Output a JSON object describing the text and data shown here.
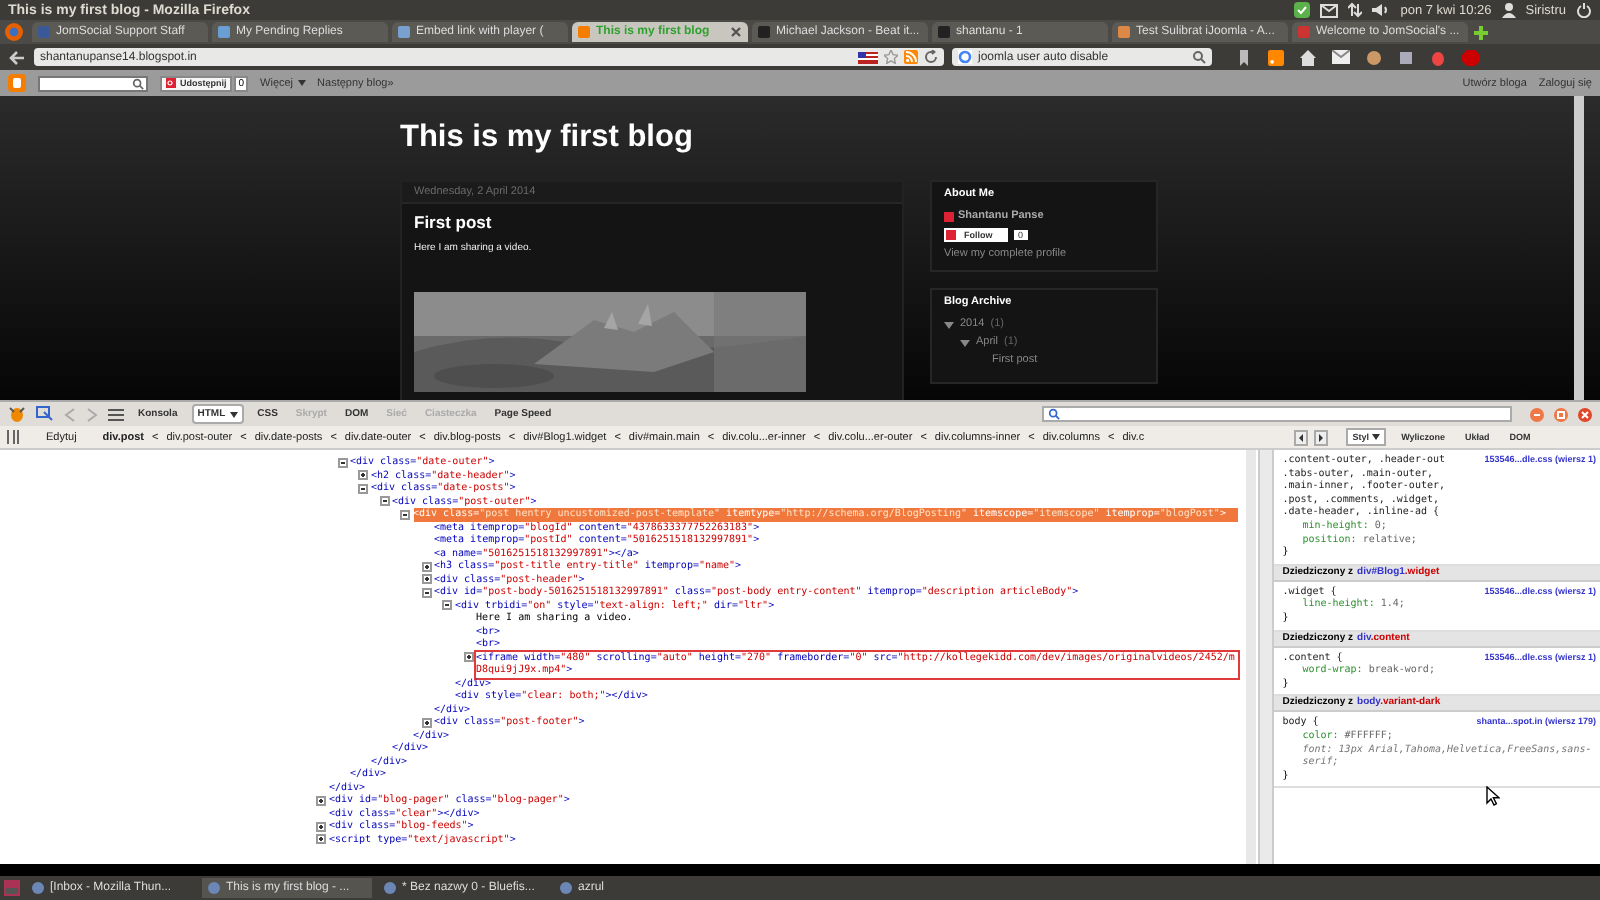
{
  "window": {
    "title": "This is my first blog - Mozilla Firefox"
  },
  "top_panel": {
    "clock": "pon 7 kwi 10:26",
    "user": "Siristru"
  },
  "browser_tabs": [
    {
      "label": "JomSocial Support Staff",
      "selected": false
    },
    {
      "label": "My Pending Replies",
      "selected": false
    },
    {
      "label": "Embed link with player (",
      "selected": false
    },
    {
      "label": "This is my first blog",
      "selected": true
    },
    {
      "label": "Michael Jackson - Beat it...",
      "selected": false
    },
    {
      "label": "shantanu - 1",
      "selected": false
    },
    {
      "label": "Test Sulibrat iJoomla - A...",
      "selected": false
    },
    {
      "label": "Welcome to JomSocial's ...",
      "selected": false
    }
  ],
  "address_bar": {
    "url": "shantanupanse14.blogspot.in"
  },
  "search_bar": {
    "value": "joomla user auto disable"
  },
  "blogger_navbar": {
    "share_button": "Udostępnij",
    "share_count": "0",
    "more_menu": "Więcej",
    "next_blog": "Następny blog»",
    "create_blog": "Utwórz bloga",
    "sign_in": "Zaloguj się"
  },
  "blog": {
    "title": "This is my first blog",
    "post": {
      "date": "Wednesday, 2 April 2014",
      "title": "First post",
      "body": "Here I am sharing a video."
    },
    "about_me": {
      "heading": "About Me",
      "name": "Shantanu Panse",
      "follow_button": "Follow",
      "follow_count": "0",
      "profile_link": "View my complete profile"
    },
    "archive": {
      "heading": "Blog Archive",
      "items": [
        {
          "label": "2014",
          "count": "(1)",
          "expanded": true,
          "children": [
            {
              "label": "April",
              "count": "(1)",
              "expanded": true,
              "children": [
                {
                  "label": "First post"
                }
              ]
            }
          ]
        }
      ]
    }
  },
  "firebug": {
    "panel_tabs": [
      {
        "label": "Konsola",
        "selected": false,
        "disabled": false
      },
      {
        "label": "HTML",
        "selected": true,
        "disabled": false
      },
      {
        "label": "CSS",
        "selected": false,
        "disabled": false
      },
      {
        "label": "Skrypt",
        "selected": false,
        "disabled": true
      },
      {
        "label": "DOM",
        "selected": false,
        "disabled": false
      },
      {
        "label": "Sieć",
        "selected": false,
        "disabled": true
      },
      {
        "label": "Ciasteczka",
        "selected": false,
        "disabled": true
      },
      {
        "label": "Page Speed",
        "selected": false,
        "disabled": false
      }
    ],
    "edit_button": "Edytuj",
    "breadcrumb_separator": "<",
    "breadcrumbs": [
      {
        "label": "div.post",
        "selected": true
      },
      {
        "label": "div.post-outer",
        "selected": false
      },
      {
        "label": "div.date-posts",
        "selected": false
      },
      {
        "label": "div.date-outer",
        "selected": false
      },
      {
        "label": "div.blog-posts",
        "selected": false
      },
      {
        "label": "div#Blog1.widget",
        "selected": false
      },
      {
        "label": "div#main.main",
        "selected": false
      },
      {
        "label": "div.colu...er-inner",
        "selected": false
      },
      {
        "label": "div.colu...er-outer",
        "selected": false
      },
      {
        "label": "div.columns-inner",
        "selected": false
      },
      {
        "label": "div.columns",
        "selected": false
      },
      {
        "label": "div.c",
        "selected": false
      }
    ],
    "side_tabs": [
      {
        "label": "Styl",
        "selected": true
      },
      {
        "label": "Wyliczone",
        "selected": false
      },
      {
        "label": "Układ",
        "selected": false
      },
      {
        "label": "DOM",
        "selected": false
      }
    ],
    "html_tree": {
      "close": "</div>",
      "children": [
        {
          "kind": "element",
          "open": "<div class=\"date-outer\">",
          "close": "</div>",
          "expanded": true,
          "selected": false,
          "outlined": false,
          "children": [
            {
              "kind": "element",
              "open": "<h2 class=\"date-header\">",
              "expanded": false,
              "selected": false,
              "outlined": false
            },
            {
              "kind": "element",
              "open": "<div class=\"date-posts\">",
              "close": "</div>",
              "expanded": true,
              "selected": false,
              "outlined": false,
              "children": [
                {
                  "kind": "element",
                  "open": "<div class=\"post-outer\">",
                  "close": "</div>",
                  "expanded": true,
                  "selected": false,
                  "outlined": false,
                  "children": [
                    {
                      "kind": "element",
                      "open": "<div class=\"post hentry uncustomized-post-template\" itemtype=\"http://schema.org/BlogPosting\" itemscope=\"itemscope\" itemprop=\"blogPost\">",
                      "close": "</div>",
                      "expanded": true,
                      "selected": true,
                      "outlined": false,
                      "children": [
                        {
                          "kind": "element",
                          "open": "<meta itemprop=\"blogId\" content=\"4378633377752263183\">",
                          "selected": false,
                          "outlined": false
                        },
                        {
                          "kind": "element",
                          "open": "<meta itemprop=\"postId\" content=\"5016251518132997891\">",
                          "selected": false,
                          "outlined": false
                        },
                        {
                          "kind": "element",
                          "open": "<a name=\"5016251518132997891\"></a>",
                          "selected": false,
                          "outlined": false
                        },
                        {
                          "kind": "element",
                          "open": "<h3 class=\"post-title entry-title\" itemprop=\"name\">",
                          "expanded": false,
                          "selected": false,
                          "outlined": false
                        },
                        {
                          "kind": "element",
                          "open": "<div class=\"post-header\">",
                          "expanded": false,
                          "selected": false,
                          "outlined": false
                        },
                        {
                          "kind": "element",
                          "open": "<div id=\"post-body-5016251518132997891\" class=\"post-body entry-content\" itemprop=\"description articleBody\">",
                          "close": "</div>",
                          "expanded": true,
                          "selected": false,
                          "outlined": false,
                          "children": [
                            {
                              "kind": "element",
                              "open": "<div trbidi=\"on\" style=\"text-align: left;\" dir=\"ltr\">",
                              "close": "</div>",
                              "expanded": true,
                              "selected": false,
                              "outlined": false,
                              "children": [
                                {
                                  "kind": "text",
                                  "open": "Here I am sharing a video.",
                                  "selected": false,
                                  "outlined": false
                                },
                                {
                                  "kind": "element",
                                  "open": "<br>",
                                  "selected": false,
                                  "outlined": false
                                },
                                {
                                  "kind": "element",
                                  "open": "<br>",
                                  "selected": false,
                                  "outlined": false
                                },
                                {
                                  "kind": "element",
                                  "open": "<iframe width=\"480\" scrolling=\"auto\" height=\"270\" frameborder=\"0\" src=\"http://kollegekidd.com/dev/images/originalvideos/2452/mD8qui9jJ9x.mp4\">",
                                  "expanded": false,
                                  "selected": false,
                                  "outlined": true
                                }
                              ]
                            },
                            {
                              "kind": "element",
                              "open": "<div style=\"clear: both;\"></div>",
                              "selected": false,
                              "outlined": false
                            }
                          ]
                        },
                        {
                          "kind": "element",
                          "open": "<div class=\"post-footer\">",
                          "expanded": false,
                          "selected": false,
                          "outlined": false
                        }
                      ]
                    }
                  ]
                }
              ]
            }
          ]
        }
      ],
      "following": [
        {
          "kind": "element",
          "open": "<div id=\"blog-pager\" class=\"blog-pager\">",
          "expanded": false,
          "selected": false,
          "outlined": false
        },
        {
          "kind": "element",
          "open": "<div class=\"clear\"></div>",
          "selected": false,
          "outlined": false
        },
        {
          "kind": "element",
          "open": "<div class=\"blog-feeds\">",
          "expanded": false,
          "selected": false,
          "outlined": false
        },
        {
          "kind": "element",
          "open": "<script type=\"text/javascript\">",
          "expanded": false,
          "selected": false,
          "outlined": false
        }
      ]
    },
    "style_sections": [
      {
        "kind": "rule",
        "selector_lines": [
          ".content-outer, .header-out",
          ".tabs-outer, .main-outer,",
          ".main-inner, .footer-outer,",
          ".post, .comments, .widget,",
          ".date-header, .inline-ad {"
        ],
        "source": "153546...dle.css (wiersz 1)",
        "declarations": [
          {
            "property": "min-height:",
            "value": "0;",
            "overridden": false
          },
          {
            "property": "position:",
            "value": "relative;",
            "overridden": false
          }
        ],
        "close": "}"
      },
      {
        "kind": "inherited",
        "label": "Dziedziczony z",
        "element": "div#Blog1",
        "element_class": ".widget"
      },
      {
        "kind": "rule",
        "selector_lines": [
          ".widget {"
        ],
        "source": "153546...dle.css (wiersz 1)",
        "declarations": [
          {
            "property": "line-height:",
            "value": "1.4;",
            "overridden": false
          }
        ],
        "close": "}"
      },
      {
        "kind": "inherited",
        "label": "Dziedziczony z",
        "element": "div",
        "element_class": ".content"
      },
      {
        "kind": "rule",
        "selector_lines": [
          ".content {"
        ],
        "source": "153546...dle.css (wiersz 1)",
        "declarations": [
          {
            "property": "word-wrap:",
            "value": "break-word;",
            "overridden": false
          }
        ],
        "close": "}"
      },
      {
        "kind": "inherited",
        "label": "Dziedziczony z",
        "element": "body",
        "element_class": ".variant-dark"
      },
      {
        "kind": "rule",
        "selector_lines": [
          "body {"
        ],
        "source": "shanta...spot.in (wiersz 179)",
        "declarations": [
          {
            "property": "color:",
            "value": "#FFFFFF;",
            "overridden": false
          },
          {
            "property": "font:",
            "value": "13px Arial,Tahoma,Helvetica,FreeSans,sans-serif;",
            "overridden": true
          }
        ],
        "close": "}"
      }
    ]
  },
  "taskbar": [
    {
      "label": "[Inbox - Mozilla Thun...",
      "selected": false
    },
    {
      "label": "This is my first blog - ...",
      "selected": true
    },
    {
      "label": "* Bez nazwy 0 - Bluefis...",
      "selected": false
    },
    {
      "label": "azrul",
      "selected": false
    }
  ]
}
